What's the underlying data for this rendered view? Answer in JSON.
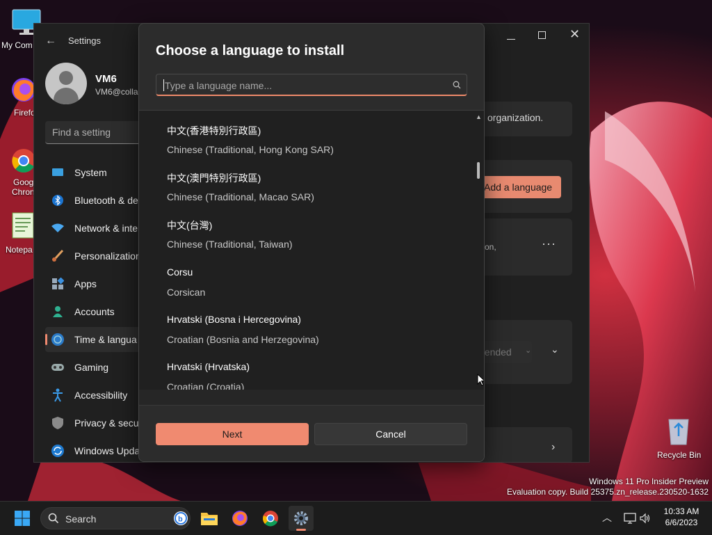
{
  "colors": {
    "accent": "#f08a70",
    "dialog_bg": "#2c2c2c",
    "list_bg": "#202020"
  },
  "desktop": {
    "icons": [
      {
        "label": "My Com",
        "icon": "monitor-icon"
      },
      {
        "label": "Firefo",
        "icon": "firefox-icon"
      },
      {
        "label": "Goog",
        "label2": "Chron",
        "icon": "chrome-icon"
      },
      {
        "label": "Notepa",
        "icon": "notepad-icon"
      }
    ],
    "recycle_bin": "Recycle Bin",
    "watermark_line1": "Windows 11 Pro Insider Preview",
    "watermark_line2": "Evaluation copy. Build 25375.zn_release.230520-1632"
  },
  "settings": {
    "title": "Settings",
    "user_name": "VM6",
    "user_email": "VM6@collal",
    "find_placeholder": "Find a setting",
    "nav": [
      {
        "label": "System",
        "icon": "system-icon"
      },
      {
        "label": "Bluetooth & de",
        "icon": "bluetooth-icon"
      },
      {
        "label": "Network & inte",
        "icon": "network-icon"
      },
      {
        "label": "Personalization",
        "icon": "brush-icon"
      },
      {
        "label": "Apps",
        "icon": "apps-icon"
      },
      {
        "label": "Accounts",
        "icon": "accounts-icon"
      },
      {
        "label": "Time & langua",
        "icon": "time-language-icon"
      },
      {
        "label": "Gaming",
        "icon": "gaming-icon"
      },
      {
        "label": "Accessibility",
        "icon": "accessibility-icon"
      },
      {
        "label": "Privacy & secu",
        "icon": "shield-icon"
      },
      {
        "label": "Windows Upda",
        "icon": "update-icon"
      }
    ],
    "bg_org_text": "organization.",
    "bg_add_language": "Add a language",
    "bg_card_text": "on,",
    "bg_dropdown": "nended"
  },
  "dialog": {
    "title": "Choose a language to install",
    "search_placeholder": "Type a language name...",
    "languages": [
      {
        "native": "中文(香港特別行政區)",
        "english": "Chinese (Traditional, Hong Kong SAR)"
      },
      {
        "native": "中文(澳門特別行政區)",
        "english": "Chinese (Traditional, Macao SAR)"
      },
      {
        "native": "中文(台灣)",
        "english": "Chinese (Traditional, Taiwan)"
      },
      {
        "native": "Corsu",
        "english": "Corsican"
      },
      {
        "native": "Hrvatski (Bosna i Hercegovina)",
        "english": "Croatian (Bosnia and Herzegovina)"
      },
      {
        "native": "Hrvatski (Hrvatska)",
        "english": "Croatian (Croatia)"
      }
    ],
    "next_label": "Next",
    "cancel_label": "Cancel"
  },
  "taskbar": {
    "search_label": "Search",
    "time": "10:33 AM",
    "date": "6/6/2023"
  }
}
